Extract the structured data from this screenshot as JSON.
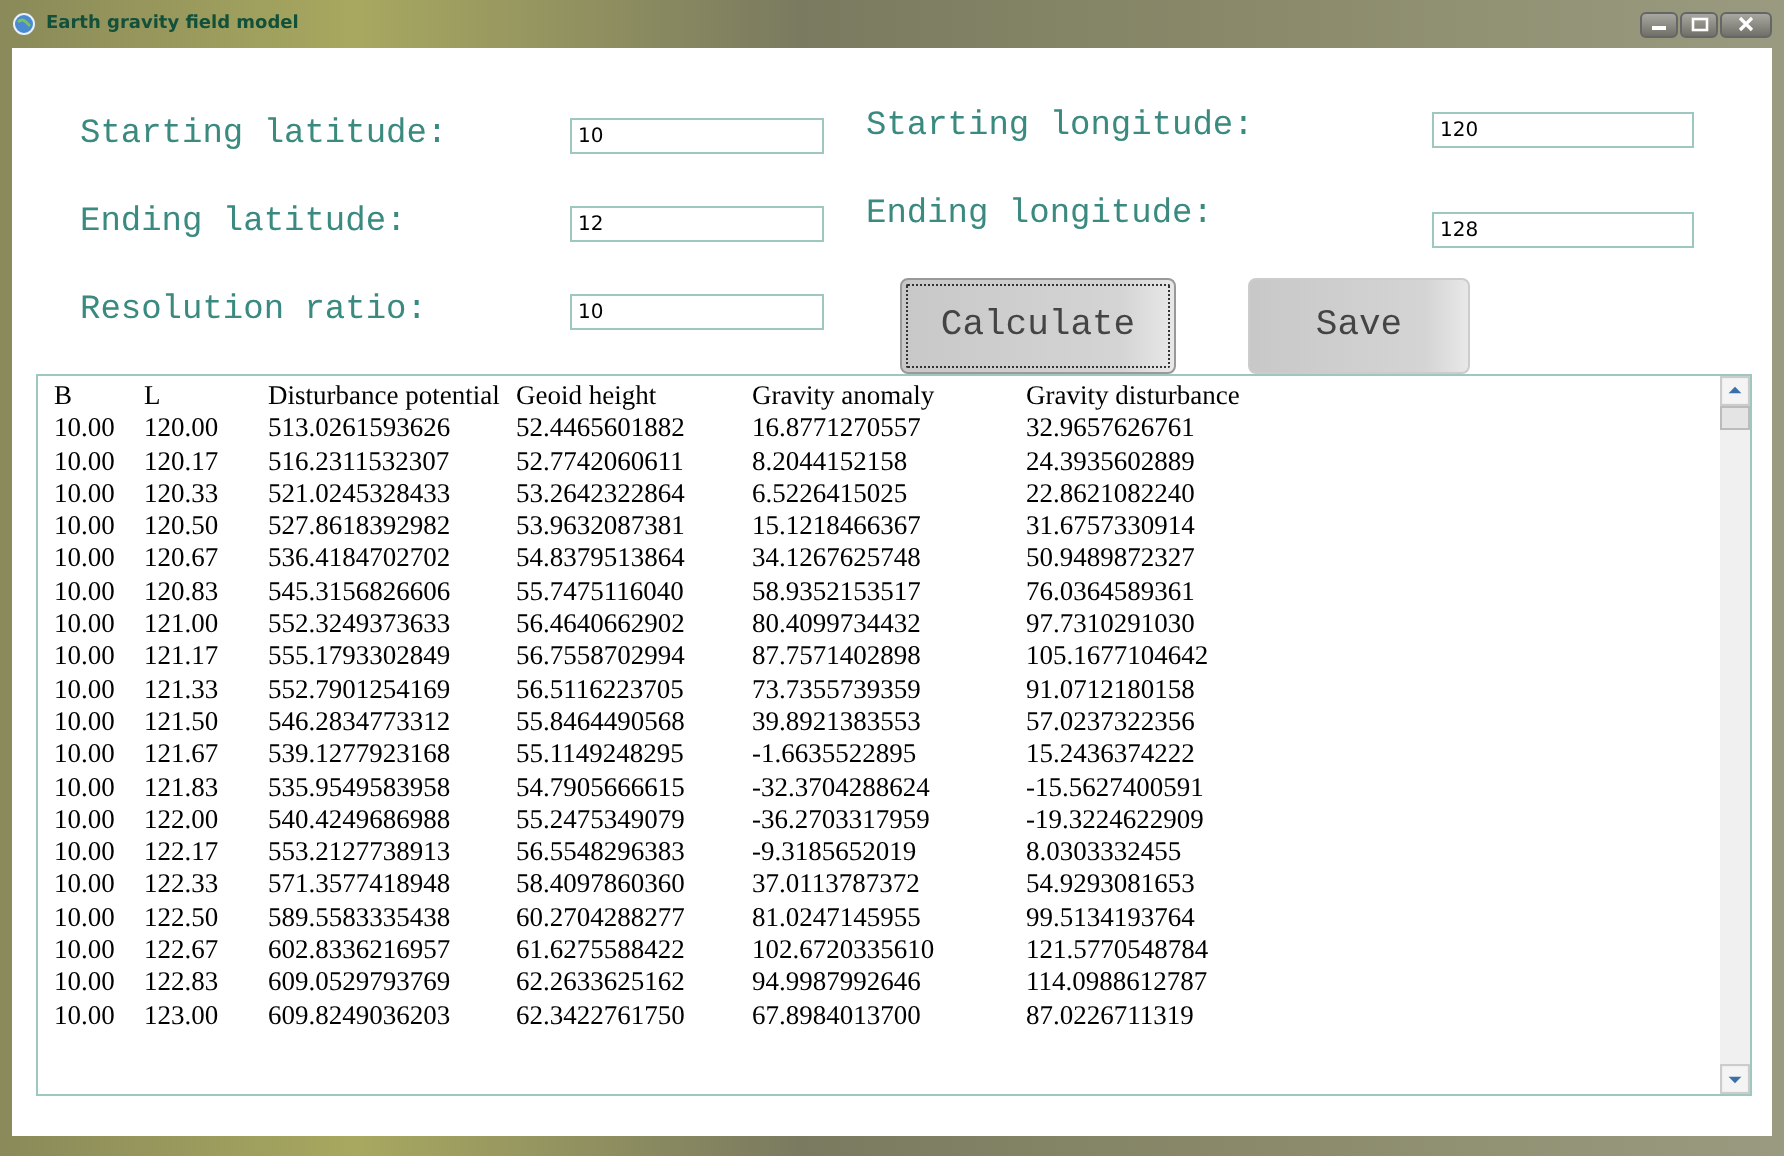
{
  "window": {
    "title": "Earth gravity field model"
  },
  "fields": [
    {
      "label": "Starting latitude:",
      "value": "10"
    },
    {
      "label": "Starting longitude:",
      "value": "120"
    },
    {
      "label": "Ending latitude:",
      "value": "12"
    },
    {
      "label": "Ending longitude:",
      "value": "128"
    },
    {
      "label": "Resolution ratio:",
      "value": "10"
    }
  ],
  "buttons": [
    {
      "label": "Calculate",
      "focused": true
    },
    {
      "label": "Save",
      "focused": false
    }
  ],
  "table": {
    "columns": [
      "B",
      "L",
      "Disturbance potential",
      "Geoid height",
      "Gravity anomaly",
      "Gravity disturbance"
    ],
    "rows": [
      [
        "10.00",
        "120.00",
        "513.0261593626",
        "52.4465601882",
        "16.8771270557",
        "32.9657626761"
      ],
      [
        "10.00",
        "120.17",
        "516.2311532307",
        "52.7742060611",
        "8.2044152158",
        "24.3935602889"
      ],
      [
        "10.00",
        "120.33",
        "521.0245328433",
        "53.2642322864",
        "6.5226415025",
        "22.8621082240"
      ],
      [
        "10.00",
        "120.50",
        "527.8618392982",
        "53.9632087381",
        "15.1218466367",
        "31.6757330914"
      ],
      [
        "10.00",
        "120.67",
        "536.4184702702",
        "54.8379513864",
        "34.1267625748",
        "50.9489872327"
      ],
      [
        "10.00",
        "120.83",
        "545.3156826606",
        "55.7475116040",
        "58.9352153517",
        "76.0364589361"
      ],
      [
        "10.00",
        "121.00",
        "552.3249373633",
        "56.4640662902",
        "80.4099734432",
        "97.7310291030"
      ],
      [
        "10.00",
        "121.17",
        "555.1793302849",
        "56.7558702994",
        "87.7571402898",
        "105.1677104642"
      ],
      [
        "10.00",
        "121.33",
        "552.7901254169",
        "56.5116223705",
        "73.7355739359",
        "91.0712180158"
      ],
      [
        "10.00",
        "121.50",
        "546.2834773312",
        "55.8464490568",
        "39.8921383553",
        "57.0237322356"
      ],
      [
        "10.00",
        "121.67",
        "539.1277923168",
        "55.1149248295",
        "-1.6635522895",
        "15.2436374222"
      ],
      [
        "10.00",
        "121.83",
        "535.9549583958",
        "54.7905666615",
        "-32.3704288624",
        "-15.5627400591"
      ],
      [
        "10.00",
        "122.00",
        "540.4249686988",
        "55.2475349079",
        "-36.2703317959",
        "-19.3224622909"
      ],
      [
        "10.00",
        "122.17",
        "553.2127738913",
        "56.5548296383",
        "-9.3185652019",
        "8.0303332455"
      ],
      [
        "10.00",
        "122.33",
        "571.3577418948",
        "58.4097860360",
        "37.0113787372",
        "54.9293081653"
      ],
      [
        "10.00",
        "122.50",
        "589.5583335438",
        "60.2704288277",
        "81.0247145955",
        "99.5134193764"
      ],
      [
        "10.00",
        "122.67",
        "602.8336216957",
        "61.6275588422",
        "102.6720335610",
        "121.5770548784"
      ],
      [
        "10.00",
        "122.83",
        "609.0529793769",
        "62.2633625162",
        "94.9987992646",
        "114.0988612787"
      ],
      [
        "10.00",
        "123.00",
        "609.8249036203",
        "62.3422761750",
        "67.8984013700",
        "87.0226711319"
      ]
    ]
  }
}
